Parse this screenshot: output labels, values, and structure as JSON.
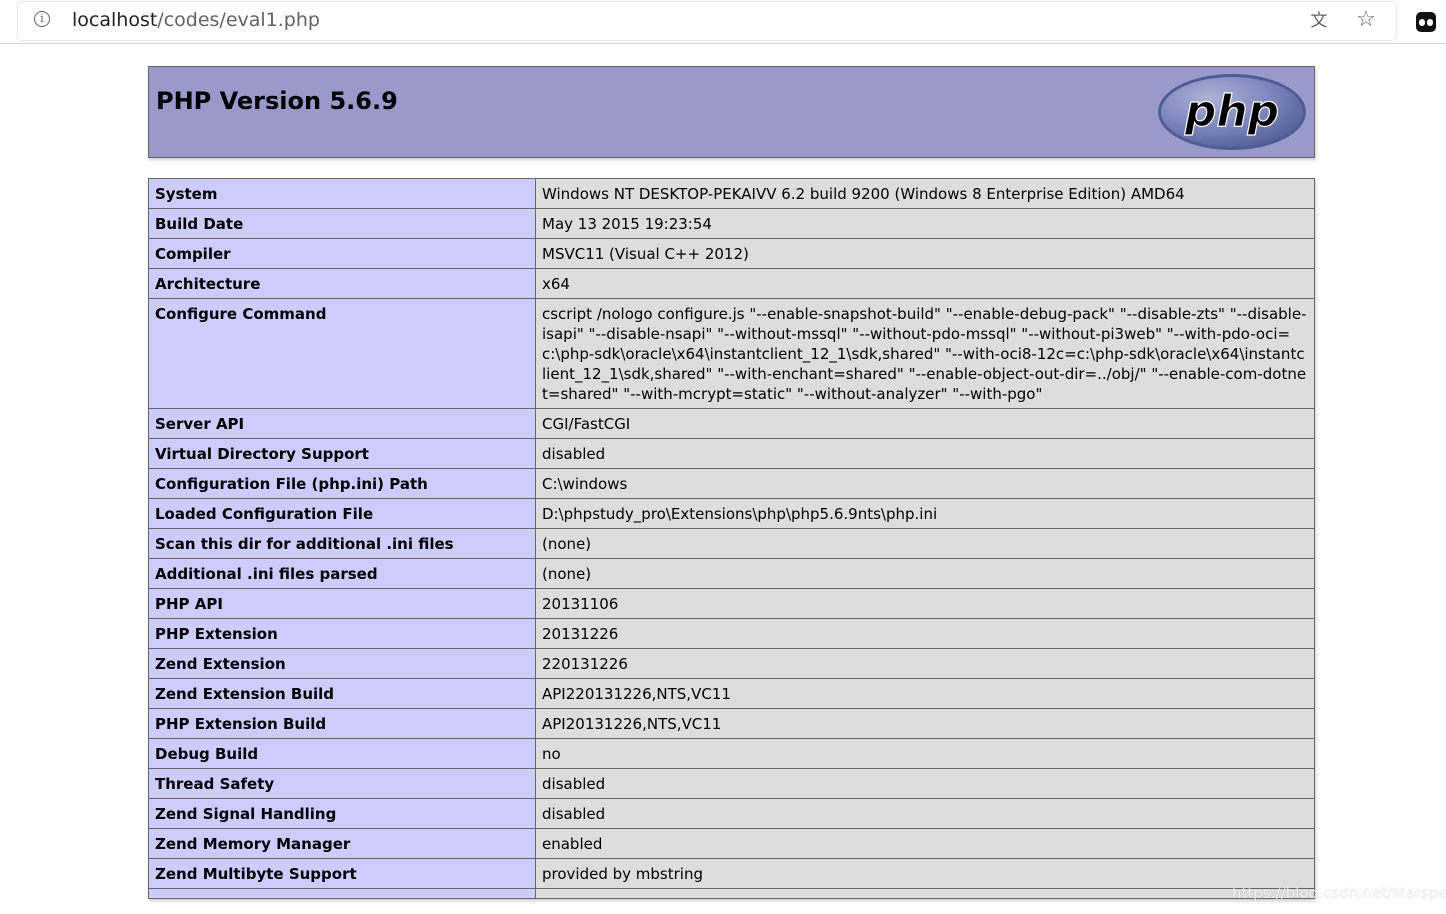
{
  "browser": {
    "url_host": "localhost",
    "url_path": "/codes/eval1.php",
    "icons": [
      "info-icon",
      "translate-icon",
      "star-icon",
      "extension-icon"
    ]
  },
  "header": {
    "title": "PHP Version 5.6.9",
    "logo_text": "php"
  },
  "rows": [
    {
      "label": "System",
      "value": "Windows NT DESKTOP-PEKAIVV 6.2 build 9200 (Windows 8 Enterprise Edition) AMD64"
    },
    {
      "label": "Build Date",
      "value": "May 13 2015 19:23:54"
    },
    {
      "label": "Compiler",
      "value": "MSVC11 (Visual C++ 2012)"
    },
    {
      "label": "Architecture",
      "value": "x64"
    },
    {
      "label": "Configure Command",
      "value": "cscript /nologo configure.js \"--enable-snapshot-build\" \"--enable-debug-pack\" \"--disable-zts\" \"--disable-isapi\" \"--disable-nsapi\" \"--without-mssql\" \"--without-pdo-mssql\" \"--without-pi3web\" \"--with-pdo-oci=c:\\php-sdk\\oracle\\x64\\instantclient_12_1\\sdk,shared\" \"--with-oci8-12c=c:\\php-sdk\\oracle\\x64\\instantclient_12_1\\sdk,shared\" \"--with-enchant=shared\" \"--enable-object-out-dir=../obj/\" \"--enable-com-dotnet=shared\" \"--with-mcrypt=static\" \"--without-analyzer\" \"--with-pgo\""
    },
    {
      "label": "Server API",
      "value": "CGI/FastCGI"
    },
    {
      "label": "Virtual Directory Support",
      "value": "disabled"
    },
    {
      "label": "Configuration File (php.ini) Path",
      "value": "C:\\windows"
    },
    {
      "label": "Loaded Configuration File",
      "value": "D:\\phpstudy_pro\\Extensions\\php\\php5.6.9nts\\php.ini"
    },
    {
      "label": "Scan this dir for additional .ini files",
      "value": "(none)"
    },
    {
      "label": "Additional .ini files parsed",
      "value": "(none)"
    },
    {
      "label": "PHP API",
      "value": "20131106"
    },
    {
      "label": "PHP Extension",
      "value": "20131226"
    },
    {
      "label": "Zend Extension",
      "value": "220131226"
    },
    {
      "label": "Zend Extension Build",
      "value": "API220131226,NTS,VC11"
    },
    {
      "label": "PHP Extension Build",
      "value": "API20131226,NTS,VC11"
    },
    {
      "label": "Debug Build",
      "value": "no"
    },
    {
      "label": "Thread Safety",
      "value": "disabled"
    },
    {
      "label": "Zend Signal Handling",
      "value": "disabled"
    },
    {
      "label": "Zend Memory Manager",
      "value": "enabled"
    },
    {
      "label": "Zend Multibyte Support",
      "value": "provided by mbstring"
    },
    {
      "label": "",
      "value": ""
    }
  ],
  "watermark": "https://blog.csdn.net/Marsper",
  "colors": {
    "header_bg": "#9999cc",
    "label_bg": "#ccccff",
    "value_bg": "#dddddd",
    "border": "#666666"
  }
}
